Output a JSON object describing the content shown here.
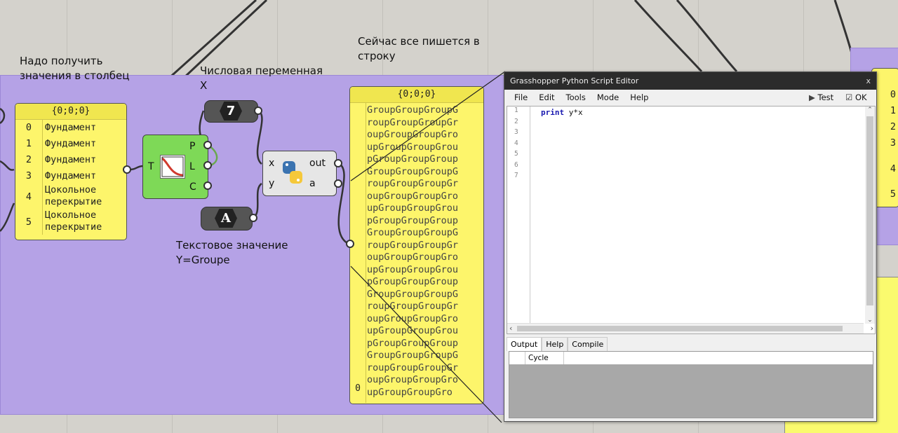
{
  "annotations": {
    "note1": "Надо получить\nзначения в столбец",
    "note2": "Числовая переменная\nX",
    "note3": "Сейчас все пишется в\nстроку",
    "note4": "Текстовое значение\nY=Groupe"
  },
  "list_panel": {
    "path": "{0;0;0}",
    "items": [
      {
        "index": "0",
        "value": "Фундамент"
      },
      {
        "index": "1",
        "value": "Фундамент"
      },
      {
        "index": "2",
        "value": "Фундамент"
      },
      {
        "index": "3",
        "value": "Фундамент"
      },
      {
        "index": "4",
        "value": "Цокольное\nперекрытие"
      },
      {
        "index": "5",
        "value": "Цокольное\nперекрытие"
      }
    ]
  },
  "path_component": {
    "input": "T",
    "outputs": [
      "P",
      "L",
      "C"
    ]
  },
  "number_param": {
    "value": "7"
  },
  "text_param": {
    "value": "A"
  },
  "python_component": {
    "inputs": [
      "x",
      "y"
    ],
    "outputs": [
      "out",
      "a"
    ]
  },
  "output_panel": {
    "path": "{0;0;0}",
    "index": "0",
    "lines": [
      "GroupGroupGroupG",
      "roupGroupGroupGr",
      "oupGroupGroupGro",
      "upGroupGroupGrou",
      "pGroupGroupGroup",
      "GroupGroupGroupG",
      "roupGroupGroupGr",
      "oupGroupGroupGro",
      "upGroupGroupGrou",
      "pGroupGroupGroup",
      "GroupGroupGroupG",
      "roupGroupGroupGr",
      "oupGroupGroupGro",
      "upGroupGroupGrou",
      "pGroupGroupGroup",
      "GroupGroupGroupG",
      "roupGroupGroupGr",
      "oupGroupGroupGro",
      "upGroupGroupGrou",
      "pGroupGroupGroup",
      "GroupGroupGroupG",
      "roupGroupGroupGr",
      "oupGroupGroupGro",
      "upGroupGroupGro"
    ]
  },
  "right_panel": {
    "indices": [
      "0",
      "1",
      "2",
      "3",
      "4",
      "5"
    ]
  },
  "editor": {
    "title": "Grasshopper Python Script Editor",
    "close": "x",
    "menu": [
      "File",
      "Edit",
      "Tools",
      "Mode",
      "Help"
    ],
    "test_label": "Test",
    "ok_label": "OK",
    "line_numbers": [
      "1",
      "2",
      "3",
      "4",
      "5",
      "6",
      "7"
    ],
    "code_keyword": "print",
    "code_rest": " y*x",
    "tabs": [
      "Output",
      "Help",
      "Compile"
    ],
    "output_columns": [
      "",
      "Cycle"
    ]
  }
}
